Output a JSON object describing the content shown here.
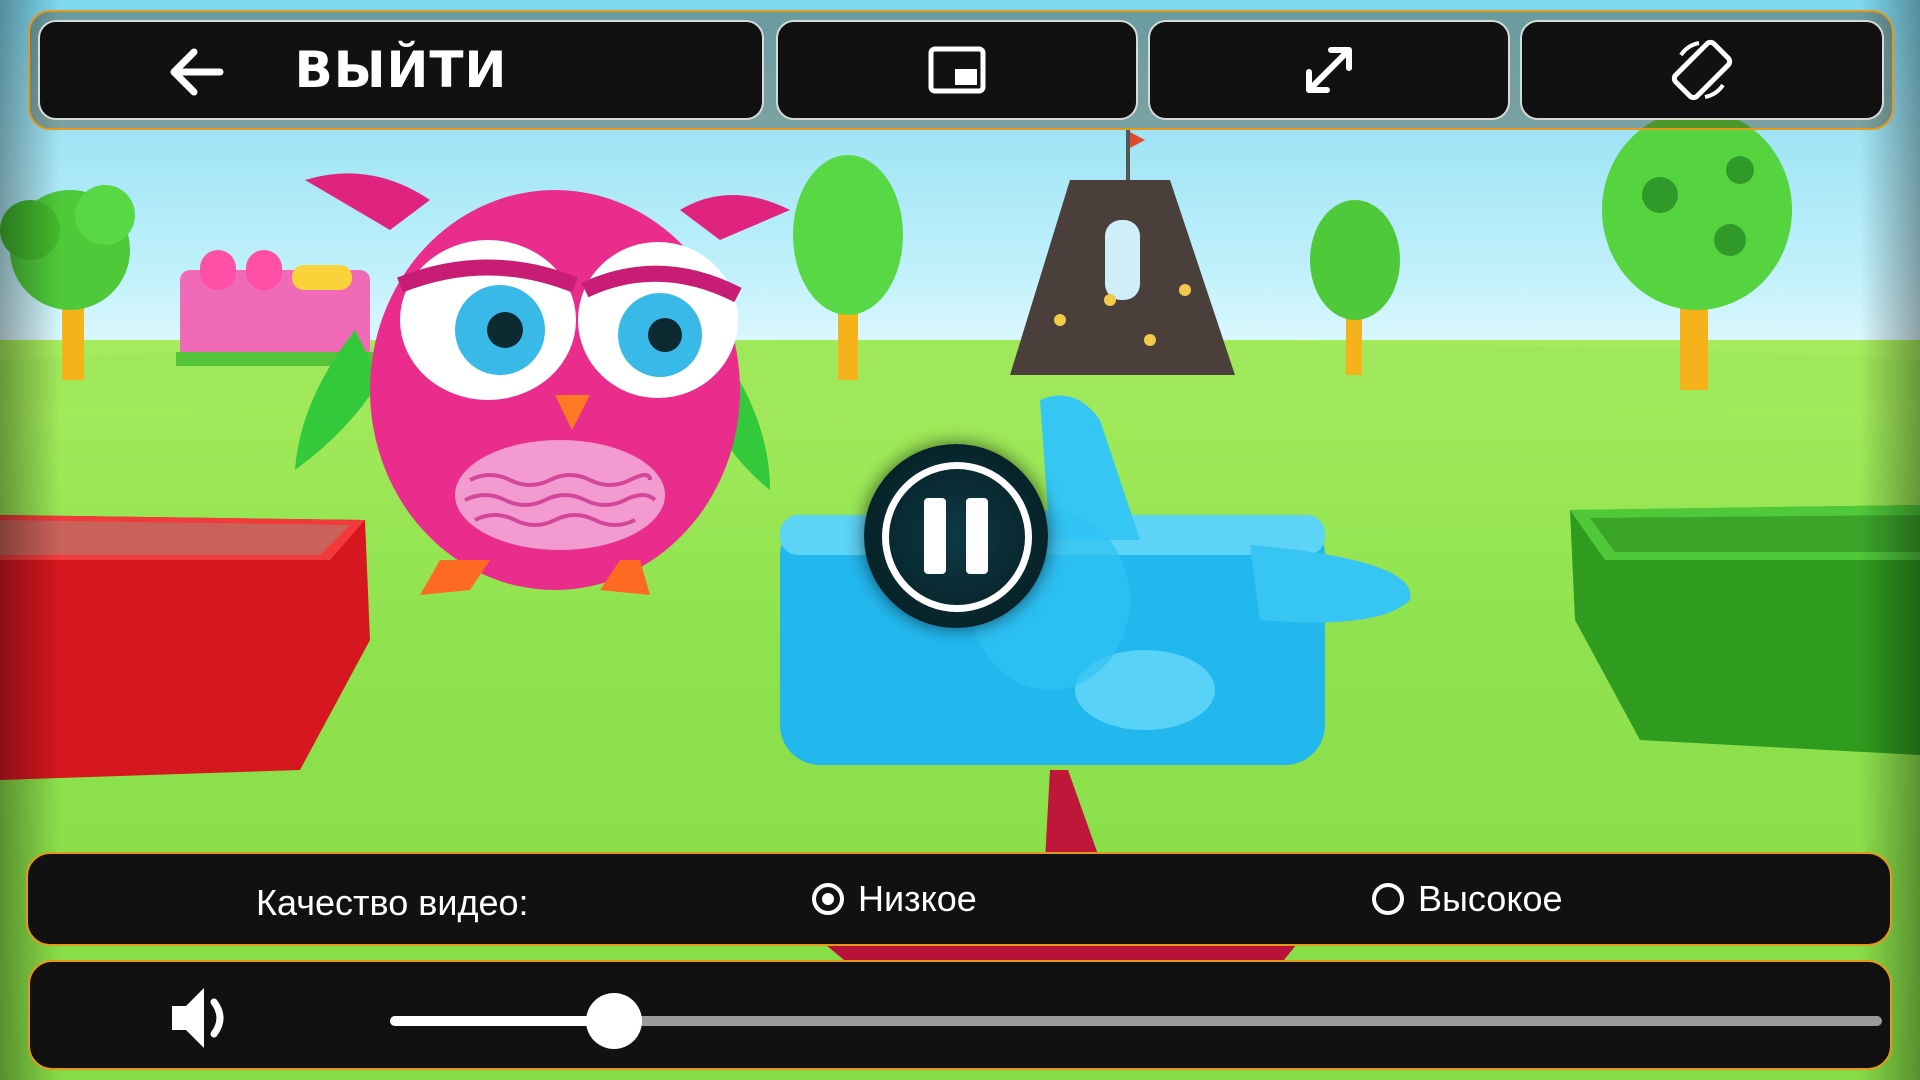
{
  "toolbar": {
    "exit_label": "ВЫЙТИ",
    "exit_icon": "arrow-left-icon",
    "pip_icon": "picture-in-picture-icon",
    "fullscreen_icon": "expand-diagonal-icon",
    "rotate_icon": "screen-rotation-icon"
  },
  "player": {
    "state_icon": "pause-icon"
  },
  "quality": {
    "label": "Качество видео:",
    "options": [
      {
        "label": "Низкое",
        "selected": true
      },
      {
        "label": "Высокое",
        "selected": false
      }
    ]
  },
  "volume": {
    "icon": "speaker-icon",
    "level_fraction": 0.15
  },
  "colors": {
    "panel_border": "#e39a1c",
    "panel_bg": "#111111",
    "accent": "#ffffff"
  }
}
